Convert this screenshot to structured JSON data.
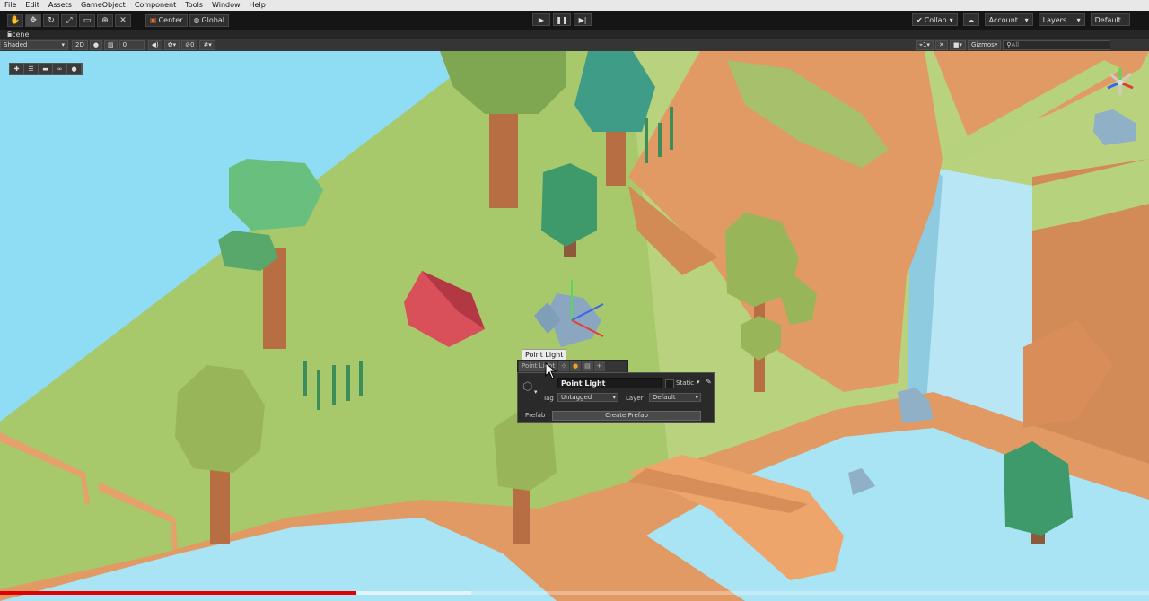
{
  "menu": [
    "File",
    "Edit",
    "Assets",
    "GameObject",
    "Component",
    "Tools",
    "Window",
    "Help"
  ],
  "toolbar": {
    "tools": [
      "hand-icon",
      "move-icon",
      "rotate-icon",
      "scale-icon",
      "rect-icon",
      "transform-icon",
      "custom-tool-icon"
    ],
    "pivot_label": "Center",
    "space_label": "Global",
    "collab_label": "Collab",
    "account_label": "Account",
    "layers_label": "Layers",
    "layout_label": "Default"
  },
  "scene_tab": {
    "label": "Scene"
  },
  "scene_bar": {
    "shading_mode": "Shaded",
    "mode_2d": "2D",
    "effects_count": "0",
    "hidden_count": "0",
    "camera_speed": "1",
    "gizmos_label": "Gizmos",
    "search_placeholder": "All"
  },
  "tooltip": {
    "text": "Point Light"
  },
  "gameobject_popup": {
    "tab_label": "Point Light",
    "name": "Point Light",
    "static_label": "Static",
    "tag_label": "Tag",
    "tag_value": "Untagged",
    "layer_label": "Layer",
    "layer_value": "Default",
    "prefab_label": "Prefab",
    "create_prefab_label": "Create Prefab"
  },
  "video": {
    "progress": 0.31,
    "buffered": 0.41
  },
  "colors": {
    "sky": "#8fdcf5",
    "grass": "#a8c86c",
    "cliff": "#e29a64",
    "water": "#a9e4f5",
    "progress_red": "#e00000"
  }
}
